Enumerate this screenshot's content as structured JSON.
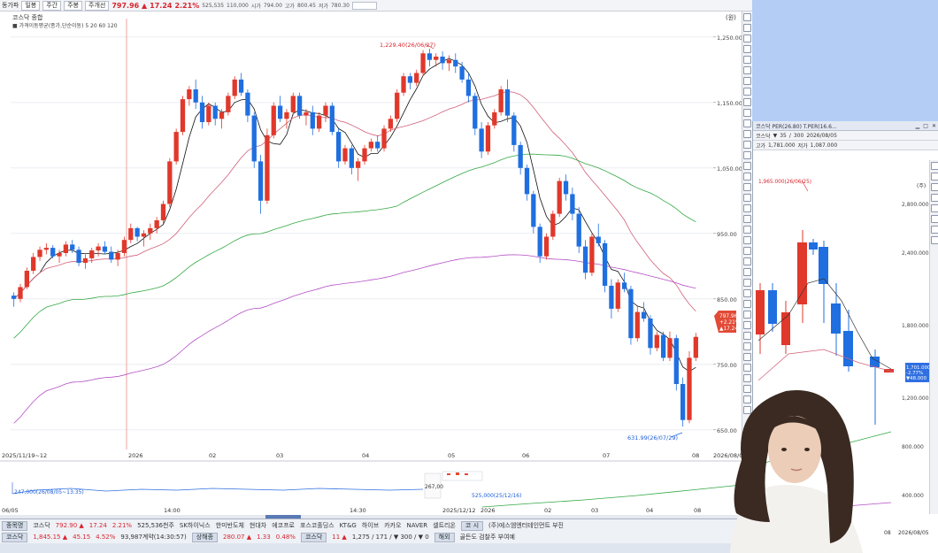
{
  "main": {
    "toolbar": {
      "label_daily": "동가파",
      "btn_day": "일봉",
      "btn_week": "주간",
      "btn_month": "주봉",
      "btn_custom": "주개선",
      "price": "797.96 ▲",
      "change": "17.24",
      "change_pct": "2.21%",
      "volume": "525,535",
      "amount": "110,000",
      "open_label": "시가",
      "open": "794.00",
      "high_label": "고가",
      "high": "800.45",
      "low_label": "저가",
      "low": "780.30"
    },
    "index_name": "코스닥 종합",
    "ma_legend": "■ 가격이동평균(종가,단순이동) 5 20 60 120",
    "annotations": {
      "high": "1,229.40(26/06/27)",
      "low": "631.99(26/07/29)",
      "sub_low": "247,000(26/08/05~13:35)",
      "sub_mid": "525,000(25/12/16)",
      "sub_left": "267,00"
    },
    "price_tag": [
      "797.96",
      "+2.21%",
      "▲17.24"
    ],
    "corner_label": "(원)",
    "bottom": {
      "row1": {
        "tab": "종목명",
        "name": "코스닥",
        "value": "792.90 ▲",
        "change": "17.24",
        "pct": "2.21%",
        "vol": "525,536천주",
        "t1": "SK하이닉스",
        "t2": "한미반도체",
        "t3": "현대차",
        "t4": "에코프로",
        "t5": "포스코홀딩스",
        "t6": "KT&G",
        "t7": "하이브",
        "t8": "카카오",
        "t9": "NAVER",
        "t10": "셀트리온",
        "side_tab": "코 시",
        "side_text": "(주)에스엠엔터테인먼트 부진"
      },
      "row2": {
        "tab": "코스닥",
        "value": "1,845.15 ▲",
        "change": "45.15",
        "pct": "4.52%",
        "vol": "93,987계약(14:30:57)",
        "m1": "상해종",
        "m1v": "280.07 ▲",
        "m1c": "1.33",
        "m1p": "0.48%",
        "m2": "코스닥",
        "m2v": "11 ▲",
        "m2c": "1,275 / 171 / ▼ 300 / ▼ 0",
        "side_tab": "해외",
        "side_text": "골든도 검찰주 부여예"
      }
    },
    "xaxis": [
      "2025/11/19~12",
      "2026",
      "02",
      "03",
      "04",
      "05",
      "06",
      "07",
      "08",
      "2026/08/05"
    ],
    "sub_xaxis": [
      "06/05",
      "14:00",
      "14:30",
      "2025/12/12",
      "2026",
      "02",
      "03",
      "04",
      "08"
    ],
    "yaxis": [
      "1,250.00",
      "1,150.00",
      "1,050.00",
      "950.00",
      "850.00",
      "750.00",
      "650.00"
    ]
  },
  "secondary": {
    "title": "코스닥 PER(26.80) T.PER(16.6...",
    "toolbar1": [
      "코스닥",
      "▼",
      "35",
      "/",
      "300",
      "2026/08/05"
    ],
    "toolbar2": [
      "고가",
      "1,781.000",
      "저가",
      "1,087.000"
    ],
    "annotation_high": "1,965.000(26/06/25)",
    "corner_label": "(주)",
    "yaxis": [
      "2,800.000",
      "2,400.000",
      "1,800.000",
      "1,200.000",
      "800.000",
      "400.000"
    ],
    "price_tag": [
      "1,701.000",
      "-2.77%",
      "▼48.000"
    ],
    "xaxis": [
      "08",
      "2026/08/05"
    ]
  },
  "chart_data": {
    "type": "candlestick",
    "title": "코스닥 종합",
    "ylim": [
      620,
      1270
    ],
    "y_ticks": [
      1250,
      1150,
      1050,
      950,
      850,
      750,
      650
    ],
    "candles": [
      [
        855,
        860,
        838,
        850
      ],
      [
        850,
        873,
        845,
        868
      ],
      [
        868,
        898,
        865,
        893
      ],
      [
        893,
        920,
        888,
        914
      ],
      [
        914,
        930,
        908,
        925
      ],
      [
        925,
        935,
        918,
        928
      ],
      [
        928,
        932,
        912,
        915
      ],
      [
        915,
        925,
        905,
        920
      ],
      [
        920,
        938,
        915,
        933
      ],
      [
        933,
        940,
        920,
        925
      ],
      [
        925,
        930,
        900,
        905
      ],
      [
        905,
        918,
        896,
        912
      ],
      [
        912,
        928,
        905,
        924
      ],
      [
        924,
        935,
        915,
        930
      ],
      [
        930,
        938,
        918,
        922
      ],
      [
        922,
        930,
        905,
        910
      ],
      [
        910,
        925,
        900,
        920
      ],
      [
        920,
        945,
        915,
        940
      ],
      [
        940,
        965,
        935,
        958
      ],
      [
        958,
        960,
        938,
        945
      ],
      [
        945,
        955,
        930,
        950
      ],
      [
        950,
        965,
        940,
        958
      ],
      [
        958,
        975,
        950,
        970
      ],
      [
        970,
        1000,
        965,
        995
      ],
      [
        995,
        1065,
        990,
        1060
      ],
      [
        1060,
        1110,
        1055,
        1105
      ],
      [
        1105,
        1160,
        1100,
        1155
      ],
      [
        1155,
        1175,
        1145,
        1170
      ],
      [
        1170,
        1185,
        1140,
        1150
      ],
      [
        1150,
        1160,
        1110,
        1120
      ],
      [
        1120,
        1150,
        1115,
        1145
      ],
      [
        1145,
        1150,
        1115,
        1125
      ],
      [
        1125,
        1140,
        1110,
        1135
      ],
      [
        1135,
        1165,
        1130,
        1160
      ],
      [
        1160,
        1190,
        1155,
        1185
      ],
      [
        1185,
        1195,
        1160,
        1165
      ],
      [
        1165,
        1170,
        1120,
        1130
      ],
      [
        1130,
        1135,
        1050,
        1060
      ],
      [
        1060,
        1070,
        980,
        1000
      ],
      [
        1000,
        1110,
        995,
        1100
      ],
      [
        1100,
        1150,
        1095,
        1145
      ],
      [
        1145,
        1160,
        1120,
        1125
      ],
      [
        1125,
        1140,
        1110,
        1135
      ],
      [
        1135,
        1165,
        1130,
        1160
      ],
      [
        1160,
        1165,
        1125,
        1130
      ],
      [
        1130,
        1140,
        1115,
        1135
      ],
      [
        1135,
        1145,
        1100,
        1110
      ],
      [
        1110,
        1135,
        1105,
        1130
      ],
      [
        1130,
        1150,
        1120,
        1145
      ],
      [
        1145,
        1150,
        1100,
        1105
      ],
      [
        1105,
        1110,
        1050,
        1060
      ],
      [
        1060,
        1085,
        1055,
        1080
      ],
      [
        1080,
        1085,
        1040,
        1050
      ],
      [
        1050,
        1065,
        1030,
        1060
      ],
      [
        1060,
        1085,
        1055,
        1080
      ],
      [
        1080,
        1095,
        1075,
        1090
      ],
      [
        1090,
        1100,
        1075,
        1080
      ],
      [
        1080,
        1115,
        1075,
        1110
      ],
      [
        1110,
        1130,
        1105,
        1125
      ],
      [
        1125,
        1170,
        1120,
        1165
      ],
      [
        1165,
        1195,
        1160,
        1190
      ],
      [
        1190,
        1195,
        1170,
        1180
      ],
      [
        1180,
        1200,
        1175,
        1195
      ],
      [
        1195,
        1230,
        1190,
        1225
      ],
      [
        1225,
        1232,
        1205,
        1215
      ],
      [
        1215,
        1225,
        1205,
        1220
      ],
      [
        1220,
        1228,
        1200,
        1210
      ],
      [
        1210,
        1222,
        1198,
        1215
      ],
      [
        1215,
        1225,
        1195,
        1205
      ],
      [
        1205,
        1212,
        1180,
        1185
      ],
      [
        1185,
        1195,
        1150,
        1160
      ],
      [
        1160,
        1165,
        1100,
        1110
      ],
      [
        1110,
        1120,
        1065,
        1075
      ],
      [
        1075,
        1120,
        1070,
        1115
      ],
      [
        1115,
        1140,
        1110,
        1135
      ],
      [
        1135,
        1175,
        1130,
        1170
      ],
      [
        1170,
        1185,
        1120,
        1130
      ],
      [
        1130,
        1135,
        1075,
        1085
      ],
      [
        1085,
        1090,
        1040,
        1050
      ],
      [
        1050,
        1055,
        1000,
        1010
      ],
      [
        1010,
        1015,
        950,
        960
      ],
      [
        960,
        965,
        905,
        915
      ],
      [
        915,
        950,
        910,
        945
      ],
      [
        945,
        985,
        940,
        980
      ],
      [
        980,
        1035,
        975,
        1030
      ],
      [
        1030,
        1040,
        1000,
        1010
      ],
      [
        1010,
        1020,
        970,
        980
      ],
      [
        980,
        990,
        920,
        930
      ],
      [
        930,
        940,
        880,
        890
      ],
      [
        890,
        950,
        885,
        945
      ],
      [
        945,
        965,
        930,
        935
      ],
      [
        935,
        940,
        860,
        870
      ],
      [
        870,
        880,
        820,
        835
      ],
      [
        835,
        880,
        830,
        875
      ],
      [
        875,
        890,
        860,
        865
      ],
      [
        865,
        870,
        780,
        790
      ],
      [
        790,
        840,
        785,
        830
      ],
      [
        830,
        845,
        815,
        820
      ],
      [
        820,
        825,
        765,
        775
      ],
      [
        775,
        800,
        770,
        795
      ],
      [
        795,
        800,
        755,
        760
      ],
      [
        760,
        800,
        755,
        790
      ],
      [
        790,
        795,
        710,
        720
      ],
      [
        720,
        730,
        655,
        665
      ],
      [
        665,
        770,
        660,
        760
      ],
      [
        760,
        798,
        755,
        792
      ]
    ],
    "series": [
      {
        "name": "5",
        "color": "#111111",
        "values": [
          850,
          870,
          893,
          914,
          925
        ]
      },
      {
        "name": "20",
        "color": "#d1607a"
      },
      {
        "name": "60",
        "color": "#33a843"
      },
      {
        "name": "120",
        "color": "#b44fc6"
      }
    ],
    "annotations": [
      {
        "label": "1,229.40(26/06/27)",
        "index": 63,
        "value": 1229.4
      },
      {
        "label": "631.99(26/07/29)",
        "index": 102,
        "value": 631.99
      }
    ]
  }
}
